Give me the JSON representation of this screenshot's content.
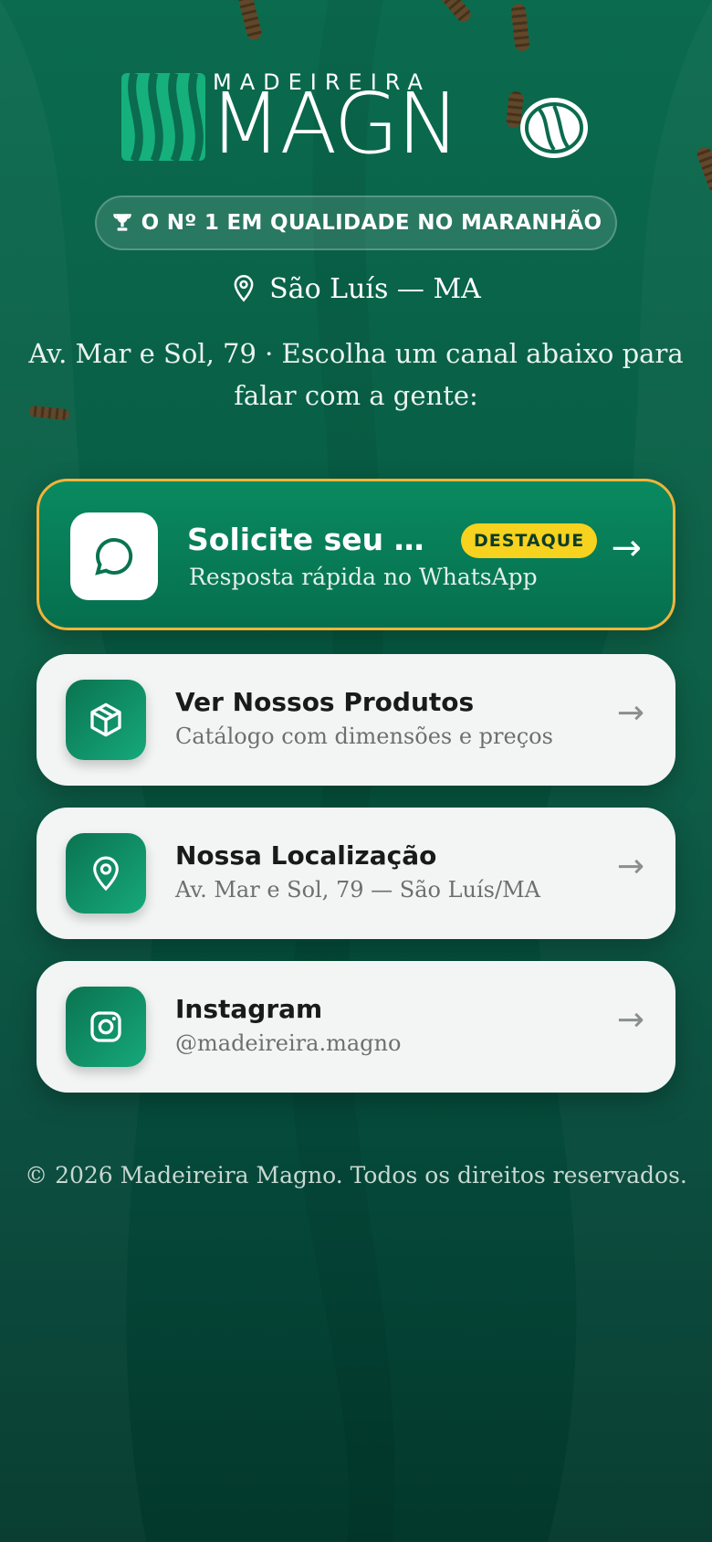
{
  "brand": {
    "name_small": "MADEIREIRA",
    "name_big": "MAGN",
    "logo_name": "madeireira-magno-logo"
  },
  "badge": {
    "icon": "trophy-icon",
    "text": "O Nº 1 EM QUALIDADE NO MARANHÃO"
  },
  "location": {
    "icon": "map-pin-icon",
    "text": "São Luís — MA"
  },
  "intro": "Av. Mar e Sol, 79 · Escolha um canal abaixo para falar com a gente:",
  "links": {
    "featured": {
      "icon": "whatsapp-chat-icon",
      "title": "Solicite seu Orçamento",
      "tag": "DESTAQUE",
      "subtitle": "Resposta rápida no WhatsApp",
      "arrow": "→"
    },
    "items": [
      {
        "icon": "box-icon",
        "title": "Ver Nossos Produtos",
        "subtitle": "Catálogo com dimensões e preços",
        "arrow": "→"
      },
      {
        "icon": "map-pin-icon",
        "title": "Nossa Localização",
        "subtitle": "Av. Mar e Sol, 79 — São Luís/MA",
        "arrow": "→"
      },
      {
        "icon": "instagram-icon",
        "title": "Instagram",
        "subtitle": "@madeireira.magno",
        "arrow": "→"
      }
    ]
  },
  "footer": "© 2026 Madeireira Magno. Todos os direitos reservados.",
  "colors": {
    "background_top": "#0b6b4e",
    "background_bottom": "#03382c",
    "accent_gold": "#f0b43a",
    "tag_yellow": "#f7d21e",
    "card_light": "#f2f5f4"
  }
}
